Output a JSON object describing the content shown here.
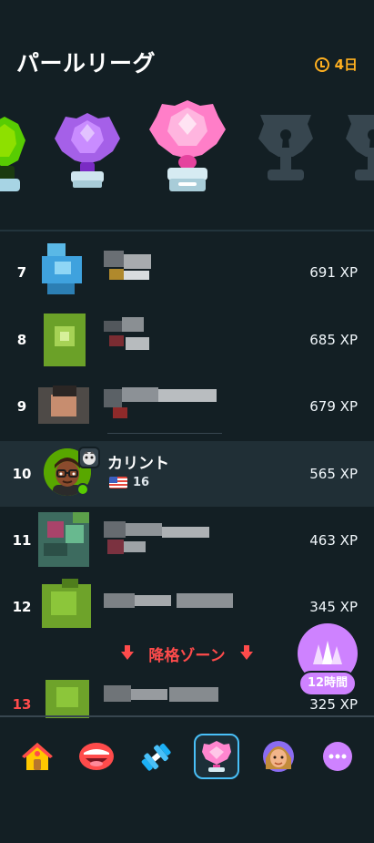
{
  "header": {
    "title": "パールリーグ",
    "time_left": "4日"
  },
  "leaderboard": [
    {
      "rank": "7",
      "xp": "691 XP"
    },
    {
      "rank": "8",
      "xp": "685 XP"
    },
    {
      "rank": "9",
      "xp": "679 XP"
    },
    {
      "rank": "10",
      "name": "カリント",
      "streak": "16",
      "xp": "565 XP",
      "is_me": true
    },
    {
      "rank": "11",
      "xp": "463 XP"
    },
    {
      "rank": "12",
      "xp": "345 XP"
    },
    {
      "rank": "13",
      "xp": "325 XP"
    }
  ],
  "demotion_zone": "降格ゾーン",
  "boost": {
    "label": "12時間"
  },
  "nav": [
    "home-icon",
    "speak-icon",
    "practice-icon",
    "leagues-icon",
    "profile-icon",
    "more-icon"
  ],
  "colors": {
    "background": "#131f24",
    "accent": "#ce82ff",
    "demotion": "#ff4b4b",
    "timer": "#ffb020"
  }
}
